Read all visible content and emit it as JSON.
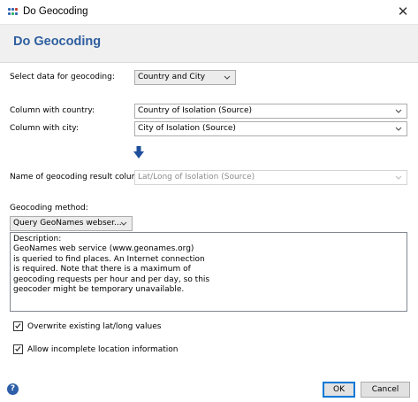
{
  "window": {
    "title": "Do Geocoding",
    "close_glyph": "✕"
  },
  "header": {
    "title": "Do Geocoding"
  },
  "form": {
    "select_data_label": "Select data for geocoding:",
    "select_data_value": "Country and City",
    "country_label": "Column with country:",
    "country_value": "Country of Isolation (Source)",
    "city_label": "Column with city:",
    "city_value": "City of Isolation (Source)",
    "result_label": "Name of geocoding result column:",
    "result_value": "Lat/Long of Isolation (Source)",
    "method_label": "Geocoding method:",
    "method_value": "Query GeoNames webser...",
    "description": "Description:\nGeoNames web service (www.geonames.org)\nis queried to find places. An Internet connection\nis required. Note that there is a maximum of\ngeocoding requests per hour and per day, so this\ngeocoder might be temporary unavailable.",
    "overwrite_label": "Overwrite existing lat/long values",
    "overwrite_checked": true,
    "incomplete_label": "Allow incomplete location information",
    "incomplete_checked": true
  },
  "footer": {
    "help_glyph": "?",
    "ok_label": "OK",
    "cancel_label": "Cancel"
  },
  "icons": {
    "app": "app-grid-icon",
    "arrow": "arrow-down-icon",
    "help": "help-icon",
    "check": "check-icon",
    "chevron": "chevron-down-icon"
  },
  "colors": {
    "heading": "#2f5f9f",
    "accent": "#0078d7",
    "arrow": "#1f4f9c"
  }
}
